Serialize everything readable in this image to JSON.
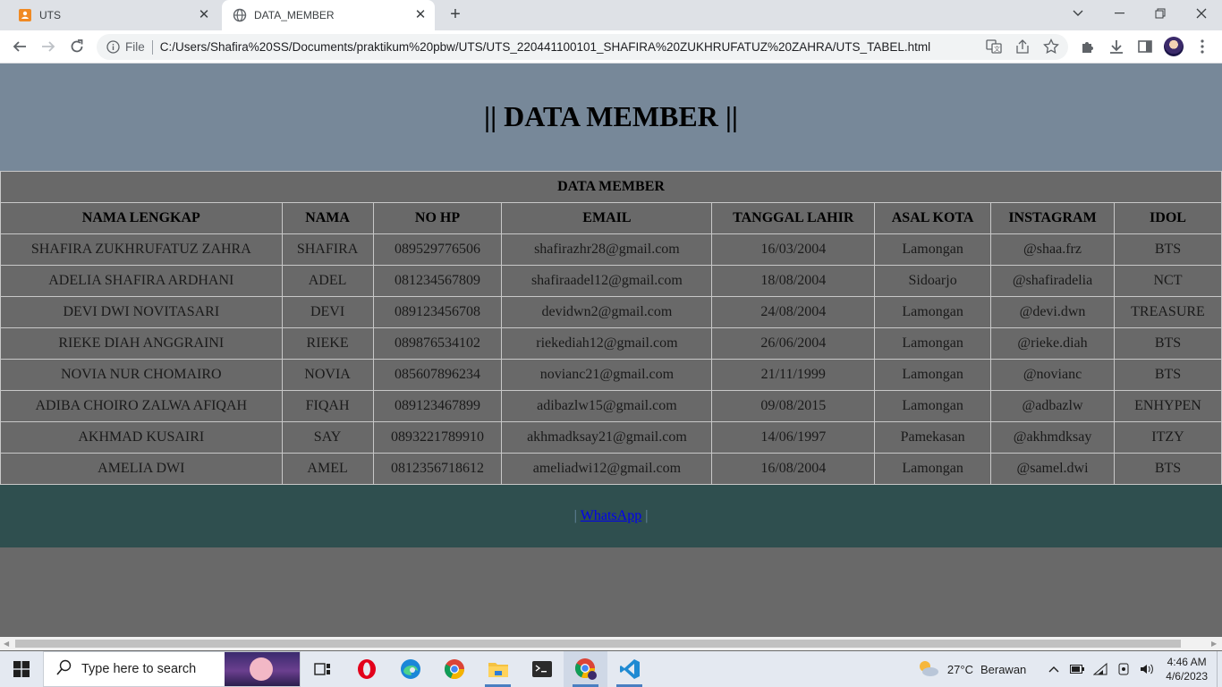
{
  "browser": {
    "tabs": [
      {
        "title": "UTS",
        "icon": "orange-app-icon"
      },
      {
        "title": "DATA_MEMBER",
        "icon": "globe-icon"
      }
    ],
    "address": {
      "scheme_label": "File",
      "url": "C:/Users/Shafira%20SS/Documents/praktikum%20pbw/UTS/UTS_220441100101_SHAFIRA%20ZUKHRUFATUZ%20ZAHRA/UTS_TABEL.html"
    }
  },
  "page": {
    "heading": "|| DATA MEMBER ||",
    "table_caption": "DATA MEMBER",
    "columns": [
      "NAMA LENGKAP",
      "NAMA",
      "NO HP",
      "EMAIL",
      "TANGGAL LAHIR",
      "ASAL KOTA",
      "INSTAGRAM",
      "IDOL"
    ],
    "rows": [
      [
        "SHAFIRA ZUKHRUFATUZ ZAHRA",
        "SHAFIRA",
        "089529776506",
        "shafirazhr28@gmail.com",
        "16/03/2004",
        "Lamongan",
        "@shaa.frz",
        "BTS"
      ],
      [
        "ADELIA SHAFIRA ARDHANI",
        "ADEL",
        "081234567809",
        "shafiraadel12@gmail.com",
        "18/08/2004",
        "Sidoarjo",
        "@shafiradelia",
        "NCT"
      ],
      [
        "DEVI DWI NOVITASARI",
        "DEVI",
        "089123456708",
        "devidwn2@gmail.com",
        "24/08/2004",
        "Lamongan",
        "@devi.dwn",
        "TREASURE"
      ],
      [
        "RIEKE DIAH ANGGRAINI",
        "RIEKE",
        "089876534102",
        "riekediah12@gmail.com",
        "26/06/2004",
        "Lamongan",
        "@rieke.diah",
        "BTS"
      ],
      [
        "NOVIA NUR CHOMAIRO",
        "NOVIA",
        "085607896234",
        "novianc21@gmail.com",
        "21/11/1999",
        "Lamongan",
        "@novianc",
        "BTS"
      ],
      [
        "ADIBA CHOIRO ZALWA AFIQAH",
        "FIQAH",
        "089123467899",
        "adibazlw15@gmail.com",
        "09/08/2015",
        "Lamongan",
        "@adbazlw",
        "ENHYPEN"
      ],
      [
        "AKHMAD KUSAIRI",
        "SAY",
        "0893221789910",
        "akhmadksay21@gmail.com",
        "14/06/1997",
        "Pamekasan",
        "@akhmdksay",
        "ITZY"
      ],
      [
        "AMELIA DWI",
        "AMEL",
        "0812356718612",
        "ameliadwi12@gmail.com",
        "16/08/2004",
        "Lamongan",
        "@samel.dwi",
        "BTS"
      ]
    ],
    "footer": {
      "left_sep": "|",
      "link_label": "WhatsApp",
      "right_sep": "|"
    }
  },
  "taskbar": {
    "search_placeholder": "Type here to search",
    "weather_temp": "27°C",
    "weather_desc": "Berawan",
    "time": "4:46 AM",
    "date": "4/6/2023"
  },
  "colors": {
    "header_bg": "#778899",
    "page_bg": "#696969",
    "footer_bg": "#2f4f4f",
    "link": "#0000ee"
  }
}
